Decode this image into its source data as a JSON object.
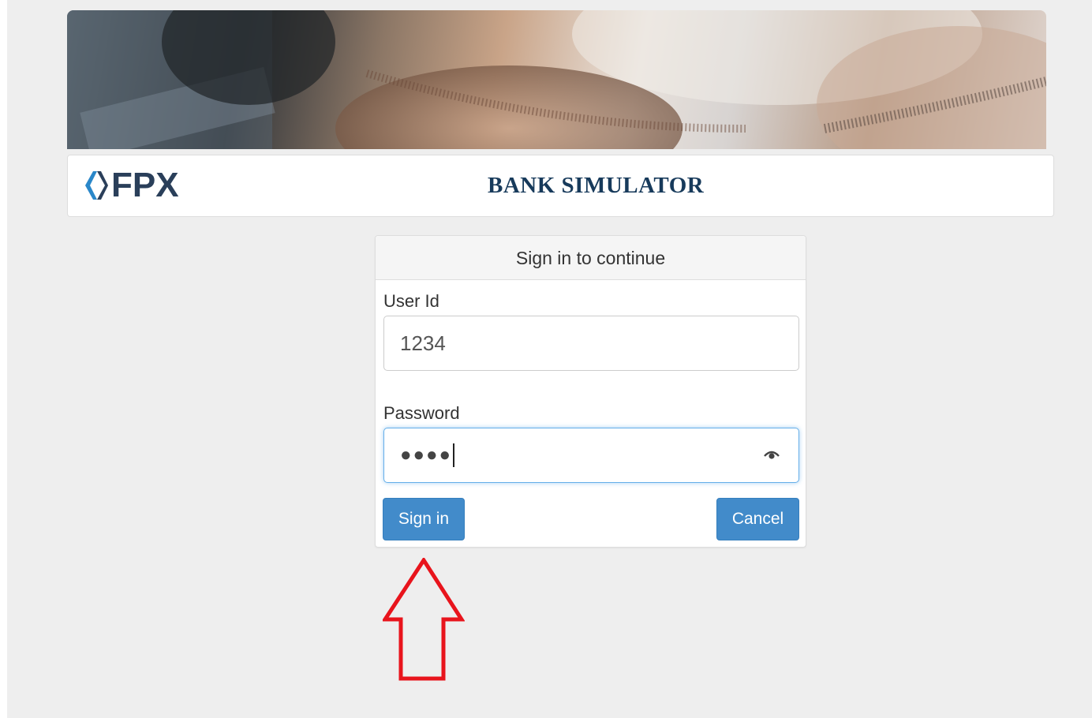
{
  "header": {
    "logo_text": "FPX",
    "title": "BANK SIMULATOR"
  },
  "login": {
    "heading": "Sign in to continue",
    "user_id_label": "User Id",
    "user_id_value": "1234",
    "password_label": "Password",
    "password_mask": "●●●●",
    "sign_in_label": "Sign in",
    "cancel_label": "Cancel"
  },
  "icons": {
    "logo": "fpx-logo-icon",
    "password_toggle": "eye-icon",
    "annotation": "red-up-arrow-icon"
  },
  "colors": {
    "primary_button": "#428bca",
    "header_title": "#173a5b",
    "annotation_arrow": "#e8141c",
    "logo_blue": "#2a87c9"
  }
}
